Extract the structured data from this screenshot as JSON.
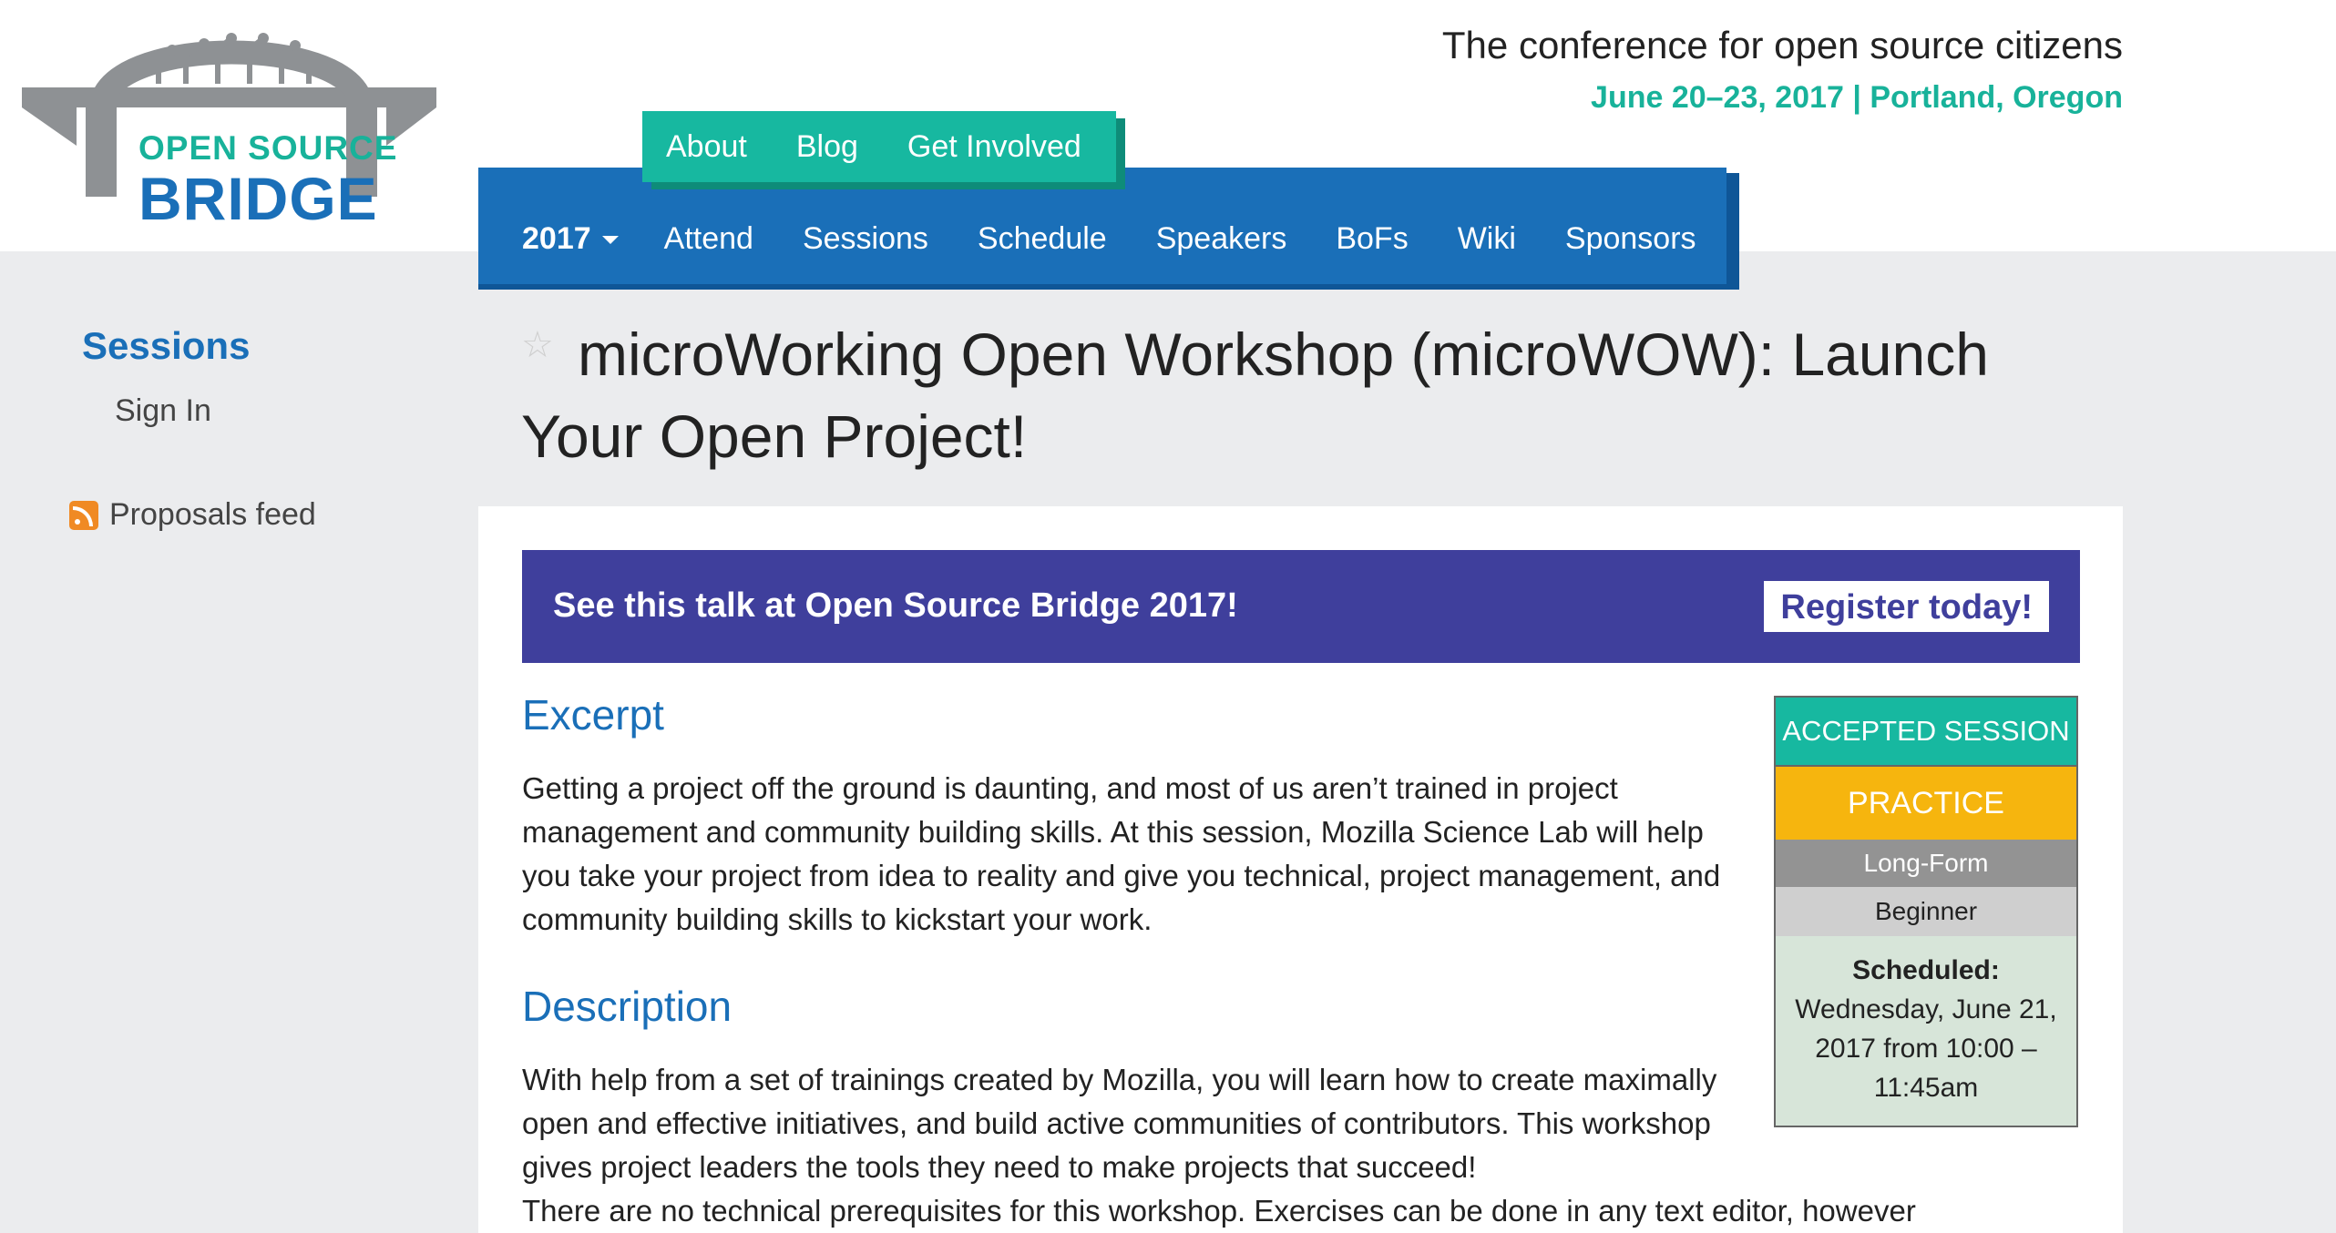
{
  "header": {
    "logo_line1": "OPEN SOURCE",
    "logo_line2": "BRIDGE",
    "tagline": "The conference for open source citizens",
    "dateline": "June 20–23, 2017 | Portland, Oregon"
  },
  "subnav": {
    "items": [
      "About",
      "Blog",
      "Get Involved"
    ]
  },
  "mainnav": {
    "year": "2017",
    "items": [
      "Attend",
      "Sessions",
      "Schedule",
      "Speakers",
      "BoFs",
      "Wiki",
      "Sponsors"
    ]
  },
  "sidebar": {
    "sessions": "Sessions",
    "sign_in": "Sign In",
    "feed": "Proposals feed"
  },
  "page": {
    "title": "microWorking Open Workshop (microWOW): Launch Your Open Project!"
  },
  "banner": {
    "text": "See this talk at Open Source Bridge 2017!",
    "button": "Register today!"
  },
  "excerpt": {
    "heading": "Excerpt",
    "text": "Getting a project off the ground is daunting, and most of us aren’t trained in project management and community building skills. At this session, Mozilla Science Lab will help you take your project from idea to reality and give you technical, project management, and community building skills to kickstart your work."
  },
  "description": {
    "heading": "Description",
    "text": "With help from a set of trainings created by Mozilla, you will learn how to create maximally open and effective initiatives, and build active communities of contributors. This workshop gives project leaders the tools they need to make projects that succeed!",
    "text2": "There are no technical prerequisites for this workshop. Exercises can be done in any text editor, however"
  },
  "session_info": {
    "status": "ACCEPTED SESSION",
    "track": "PRACTICE",
    "format": "Long-Form",
    "level": "Beginner",
    "scheduled_label": "Scheduled:",
    "scheduled_value": "Wednesday, June 21, 2017 from 10:00 – 11:45am"
  },
  "colors": {
    "brand_blue": "#1a6fb8",
    "brand_teal": "#17b8a0",
    "banner_purple": "#3f3f9c",
    "practice_yellow": "#f6b50e"
  }
}
